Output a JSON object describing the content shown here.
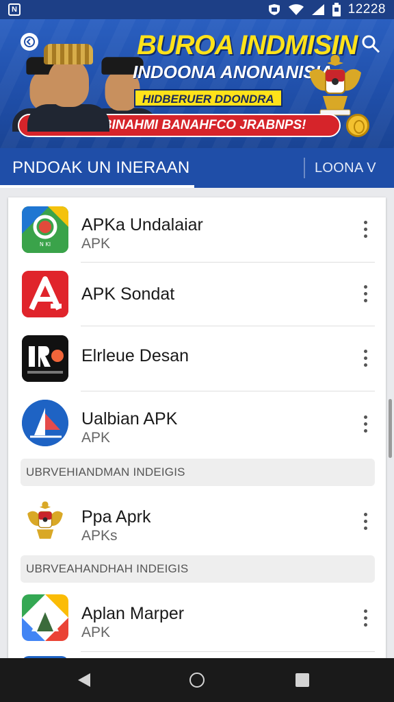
{
  "status_bar": {
    "time": "12228",
    "notification_icon": "n-notification-icon",
    "icons": [
      "shield-icon",
      "wifi-icon",
      "signal-icon",
      "battery-icon"
    ]
  },
  "banner": {
    "title": "BUROA INDMISIN",
    "subtitle": "INDOONA ANONANISIA",
    "tagline": "HIDBERUER DDONDRA",
    "ribbon": "DO BEIE UPBINAHMI BANAHFCO JRABNPS!"
  },
  "tabs": {
    "active": "PNDOAK UN INERAAN",
    "secondary": "LOONA V"
  },
  "apps": [
    {
      "title": "APKa Undalaiar",
      "subtitle": "APK",
      "icon": "maps-style-app-icon",
      "icon_text": "N KI"
    },
    {
      "title": "APK Sondat",
      "subtitle": "",
      "icon": "red-a-app-icon"
    },
    {
      "title": "Elrleue Desan",
      "subtitle": "",
      "icon": "black-rk-app-icon",
      "icon_text": "IK"
    },
    {
      "title": "Ualbian APK",
      "subtitle": "APK",
      "icon": "blue-sail-app-icon"
    }
  ],
  "section_1": {
    "label": "UBRVEHIANDMAN INDEIGIS"
  },
  "apps_2": [
    {
      "title": "Ppa Aprk",
      "subtitle": "APKs",
      "icon": "garuda-emblem-icon"
    }
  ],
  "section_2": {
    "label": "UBRVEAHANDHAH INDEIGIS"
  },
  "apps_3": [
    {
      "title": "Aplan Marper",
      "subtitle": "APK",
      "icon": "colorful-map-app-icon"
    }
  ],
  "colors": {
    "header_blue": "#1f4ea8",
    "banner_yellow": "#ffe21a",
    "ribbon_red": "#d6242a"
  }
}
